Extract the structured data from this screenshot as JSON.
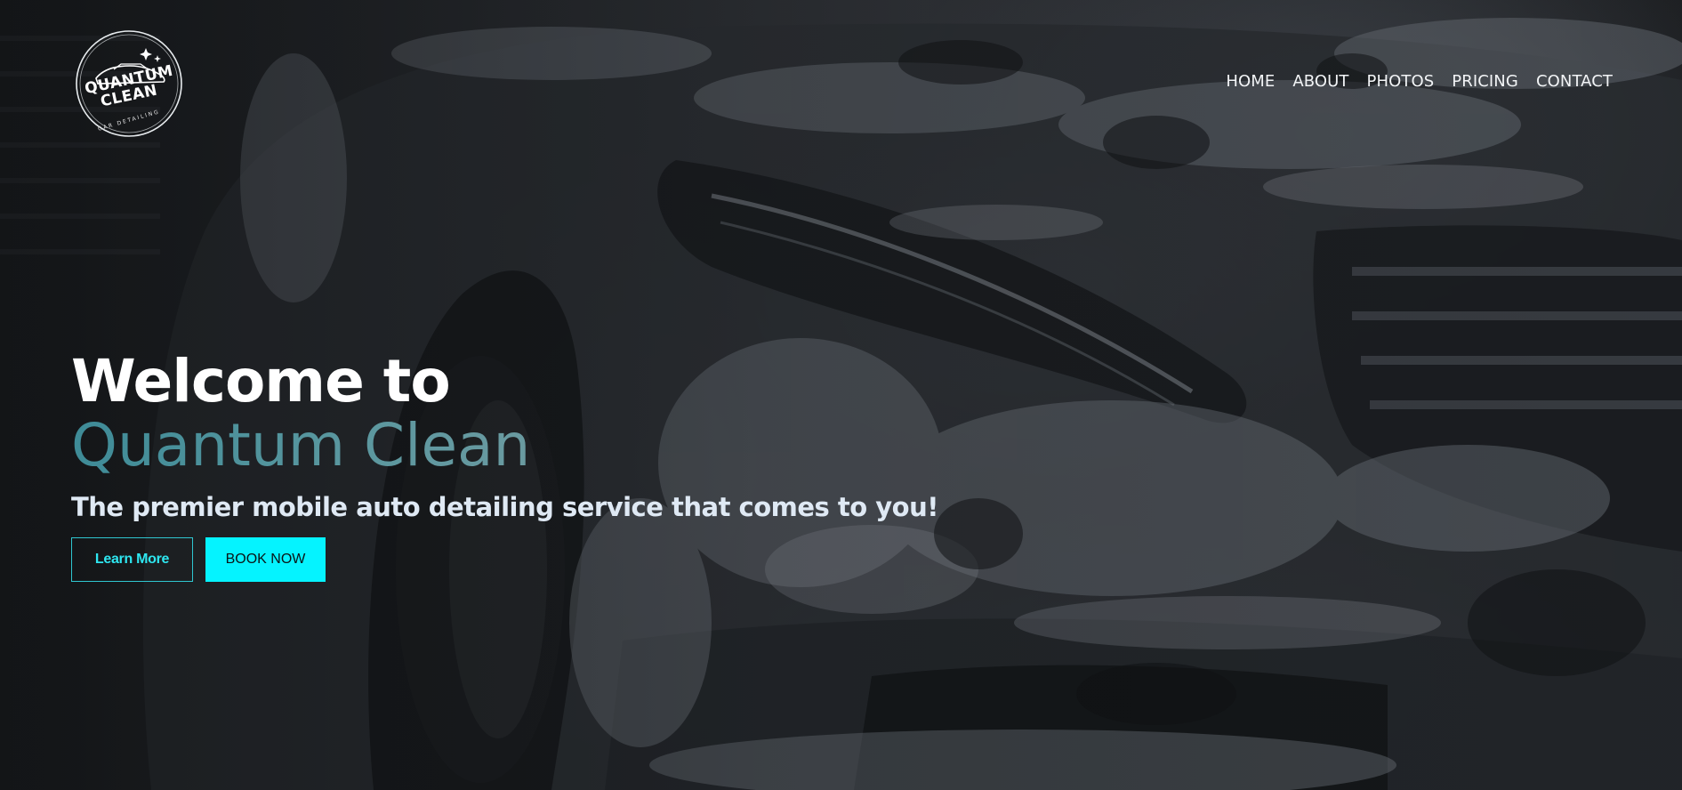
{
  "logo": {
    "line1": "QUANTUM",
    "line2": "CLEAN",
    "subtitle": "CAR DETAILING",
    "icon": "car-sparkle-badge"
  },
  "nav": {
    "items": [
      {
        "label": "HOME"
      },
      {
        "label": "ABOUT"
      },
      {
        "label": "PHOTOS"
      },
      {
        "label": "PRICING"
      },
      {
        "label": "CONTACT"
      }
    ]
  },
  "hero": {
    "heading_line1": "Welcome to",
    "heading_line2": "Quantum Clean",
    "tagline": "The premier mobile auto detailing service that comes to you!",
    "learn_more_label": "Learn More",
    "book_now_label": "BOOK NOW",
    "background_image": "foam-covered-car-headlight"
  },
  "colors": {
    "accent_cyan": "#05f3ff",
    "brand_teal": "#4b8f99",
    "tagline": "#dfe9f4",
    "background": "#1b1d20"
  }
}
